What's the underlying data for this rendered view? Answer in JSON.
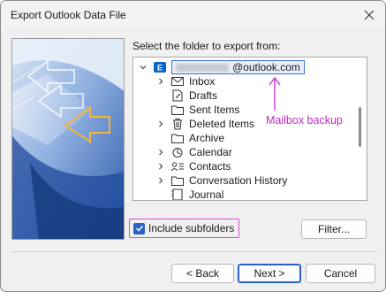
{
  "window": {
    "title": "Export Outlook Data File"
  },
  "prompt": "Select the folder to export from:",
  "tree": {
    "root_suffix": "@outlook.com",
    "items": [
      {
        "label": "Inbox",
        "expandable": true,
        "icon": "inbox-icon"
      },
      {
        "label": "Drafts",
        "expandable": false,
        "icon": "drafts-icon"
      },
      {
        "label": "Sent Items",
        "expandable": false,
        "icon": "folder-icon"
      },
      {
        "label": "Deleted Items",
        "expandable": true,
        "icon": "trash-icon"
      },
      {
        "label": "Archive",
        "expandable": false,
        "icon": "folder-icon"
      },
      {
        "label": "Calendar",
        "expandable": true,
        "icon": "calendar-icon"
      },
      {
        "label": "Contacts",
        "expandable": true,
        "icon": "contacts-icon"
      },
      {
        "label": "Conversation History",
        "expandable": true,
        "icon": "folder-icon"
      },
      {
        "label": "Journal",
        "expandable": false,
        "icon": "journal-icon"
      }
    ]
  },
  "annotation": "Mailbox backup",
  "checkbox": {
    "label": "Include subfolders",
    "checked": true
  },
  "buttons": {
    "filter": "Filter...",
    "back": "< Back",
    "next": "Next >",
    "cancel": "Cancel"
  },
  "colors": {
    "accent": "#2a62c9",
    "annotation": "#c02ac0",
    "outlook": "#0a64c8"
  }
}
